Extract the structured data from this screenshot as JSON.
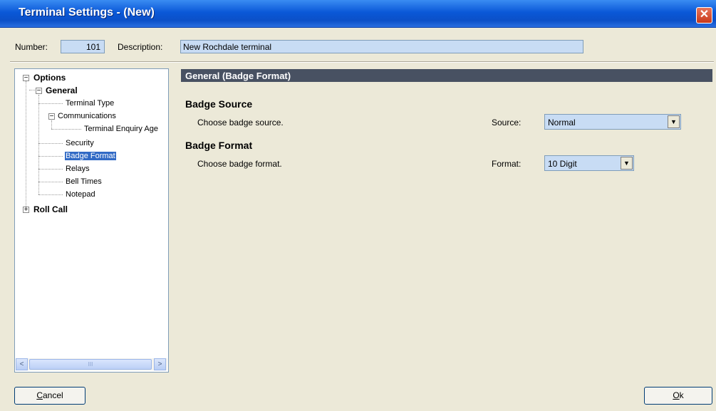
{
  "window": {
    "title": "Terminal Settings - (New)",
    "close_glyph": "✕"
  },
  "fields": {
    "number_label": "Number:",
    "number_value": "101",
    "description_label": "Description:",
    "description_value": "New Rochdale terminal"
  },
  "tree": {
    "options": "Options",
    "general": "General",
    "terminal_type": "Terminal Type",
    "communications": "Communications",
    "terminal_enquiry_agent": "Terminal Enquiry Age",
    "security": "Security",
    "badge_format": "Badge Format",
    "relays": "Relays",
    "bell_times": "Bell Times",
    "notepad": "Notepad",
    "roll_call": "Roll Call",
    "expanded_glyph": "−",
    "collapsed_glyph": "+",
    "selected_item": "Badge Format"
  },
  "scrollbar": {
    "left_arrow": "<",
    "right_arrow": ">",
    "thumb_grip": "III"
  },
  "panel": {
    "header": "General (Badge Format)",
    "badge_source": {
      "title": "Badge Source",
      "description": "Choose badge source.",
      "label": "Source:",
      "value": "Normal"
    },
    "badge_format": {
      "title": "Badge Format",
      "description": "Choose badge format.",
      "label": "Format:",
      "value": "10 Digit"
    },
    "dropdown_glyph": "▼"
  },
  "buttons": {
    "cancel_mnemonic": "C",
    "cancel_rest": "ancel",
    "ok_mnemonic": "O",
    "ok_rest": "k"
  }
}
